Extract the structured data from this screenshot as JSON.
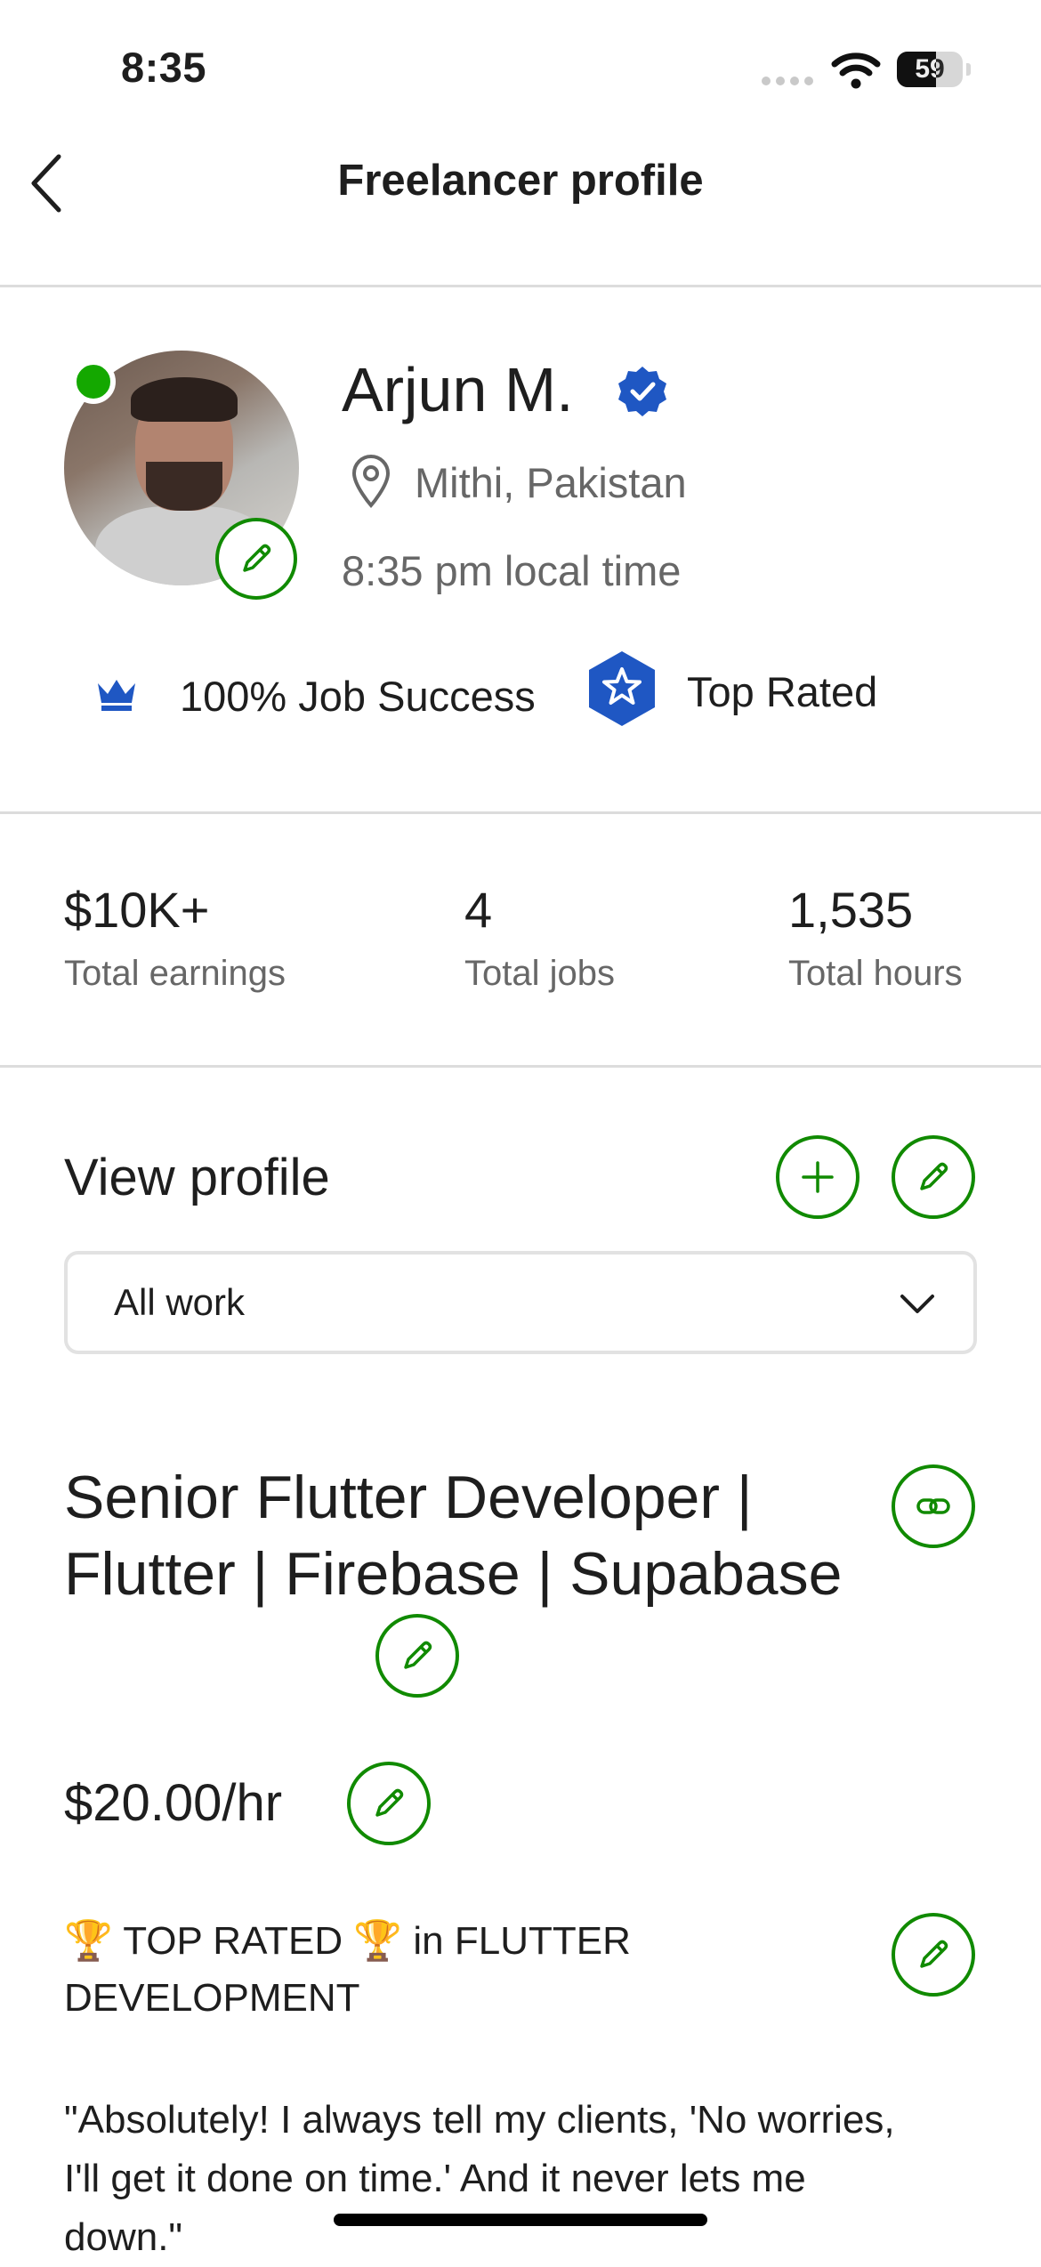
{
  "status_bar": {
    "time": "8:35",
    "battery": "59",
    "battery_level": 0.59
  },
  "header": {
    "title": "Freelancer profile"
  },
  "profile": {
    "name": "Arjun M.",
    "location": "Mithi, Pakistan",
    "local_time": "8:35 pm local time",
    "job_success": "100% Job Success",
    "badge": "Top Rated"
  },
  "stats": [
    {
      "value": "$10K+",
      "label": "Total earnings"
    },
    {
      "value": "4",
      "label": "Total jobs"
    },
    {
      "value": "1,535",
      "label": "Total hours"
    }
  ],
  "view_profile": {
    "title": "View profile",
    "dropdown_value": "All work"
  },
  "job": {
    "title": "Senior Flutter Developer | Flutter | Firebase | Supabase",
    "rate": "$20.00/hr",
    "headline": "🏆 TOP RATED 🏆 in FLUTTER DEVELOPMENT",
    "quote": "\"Absolutely! I always tell my clients, 'No worries, I'll get it done on time.' And it never lets me down.\""
  },
  "colors": {
    "accent_green": "#108a00",
    "online_green": "#14a800",
    "verified_blue": "#1f57c3",
    "text_dark": "#1e1e1e",
    "text_muted": "#676767"
  }
}
